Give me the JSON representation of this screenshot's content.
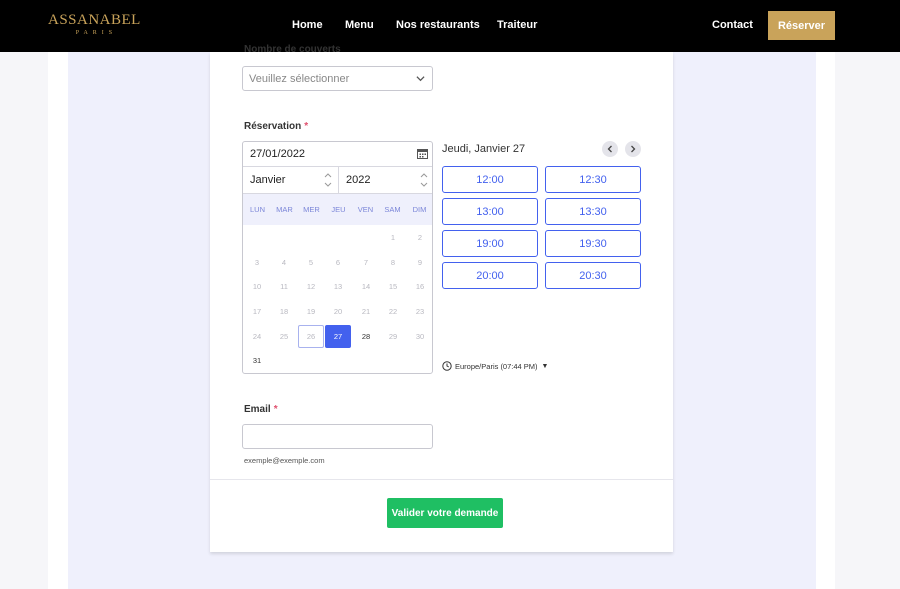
{
  "header": {
    "logo_main": "ASSANABEL",
    "logo_sub": "PARIS",
    "nav": [
      "Home",
      "Menu",
      "Nos restaurants",
      "Traiteur"
    ],
    "contact": "Contact",
    "reserve_label": "Réserver"
  },
  "form": {
    "covers_label": "Nombre de couverts",
    "covers_placeholder": "Veuillez sélectionner",
    "reservation_label": "Réservation",
    "required_mark": "*",
    "date_value": "27/01/2022",
    "month_value": "Janvier",
    "year_value": "2022",
    "weekdays": [
      "LUN",
      "MAR",
      "MER",
      "JEU",
      "VEN",
      "SAM",
      "DIM"
    ],
    "days": [
      "1",
      "2",
      "3",
      "4",
      "5",
      "6",
      "7",
      "8",
      "9",
      "10",
      "11",
      "12",
      "13",
      "14",
      "15",
      "16",
      "17",
      "18",
      "19",
      "20",
      "21",
      "22",
      "23",
      "24",
      "25",
      "26",
      "27",
      "28",
      "29",
      "30",
      "31"
    ],
    "selected_day": "27",
    "today_day": "26",
    "selected_date_title": "Jeudi, Janvier 27",
    "time_slots": [
      "12:00",
      "12:30",
      "13:00",
      "13:30",
      "19:00",
      "19:30",
      "20:00",
      "20:30"
    ],
    "timezone": "Europe/Paris (07:44 PM)",
    "email_label": "Email",
    "email_value": "",
    "email_hint": "exemple@exemple.com",
    "submit_label": "Valider votre demande"
  },
  "colors": {
    "brand_gold": "#c9a35a",
    "accent_blue": "#4361ee",
    "submit_green": "#1fbf63"
  },
  "icons": {
    "select": "chevron-down-icon",
    "date": "calendar-icon",
    "spinner": "up-down-arrows-icon",
    "prev": "chevron-left-icon",
    "next": "chevron-right-icon",
    "timezone": "clock-icon"
  }
}
